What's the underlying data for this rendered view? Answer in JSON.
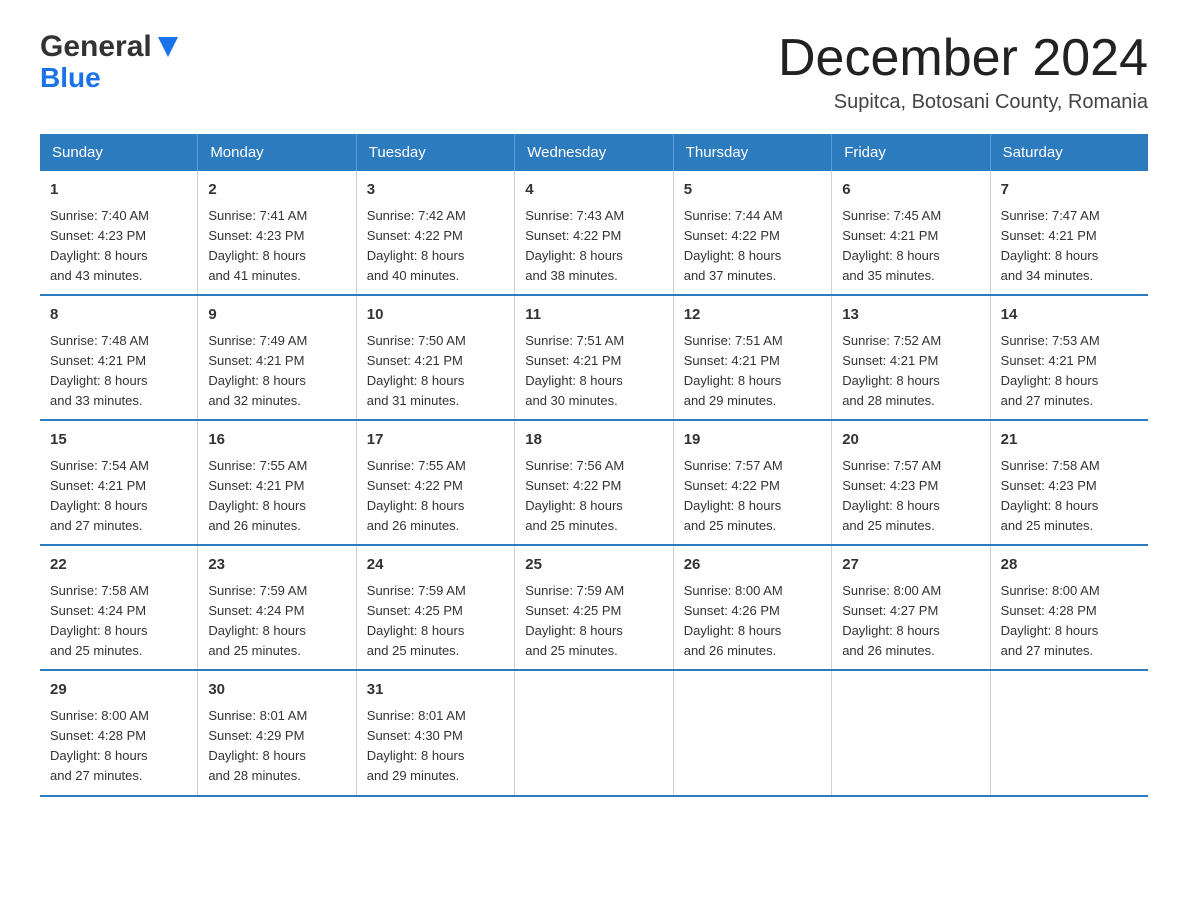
{
  "header": {
    "logo_general": "General",
    "logo_blue": "Blue",
    "title": "December 2024",
    "subtitle": "Supitca, Botosani County, Romania"
  },
  "days_of_week": [
    "Sunday",
    "Monday",
    "Tuesday",
    "Wednesday",
    "Thursday",
    "Friday",
    "Saturday"
  ],
  "weeks": [
    [
      {
        "day": "1",
        "sunrise": "7:40 AM",
        "sunset": "4:23 PM",
        "daylight_h": "8",
        "daylight_m": "43"
      },
      {
        "day": "2",
        "sunrise": "7:41 AM",
        "sunset": "4:23 PM",
        "daylight_h": "8",
        "daylight_m": "41"
      },
      {
        "day": "3",
        "sunrise": "7:42 AM",
        "sunset": "4:22 PM",
        "daylight_h": "8",
        "daylight_m": "40"
      },
      {
        "day": "4",
        "sunrise": "7:43 AM",
        "sunset": "4:22 PM",
        "daylight_h": "8",
        "daylight_m": "38"
      },
      {
        "day": "5",
        "sunrise": "7:44 AM",
        "sunset": "4:22 PM",
        "daylight_h": "8",
        "daylight_m": "37"
      },
      {
        "day": "6",
        "sunrise": "7:45 AM",
        "sunset": "4:21 PM",
        "daylight_h": "8",
        "daylight_m": "35"
      },
      {
        "day": "7",
        "sunrise": "7:47 AM",
        "sunset": "4:21 PM",
        "daylight_h": "8",
        "daylight_m": "34"
      }
    ],
    [
      {
        "day": "8",
        "sunrise": "7:48 AM",
        "sunset": "4:21 PM",
        "daylight_h": "8",
        "daylight_m": "33"
      },
      {
        "day": "9",
        "sunrise": "7:49 AM",
        "sunset": "4:21 PM",
        "daylight_h": "8",
        "daylight_m": "32"
      },
      {
        "day": "10",
        "sunrise": "7:50 AM",
        "sunset": "4:21 PM",
        "daylight_h": "8",
        "daylight_m": "31"
      },
      {
        "day": "11",
        "sunrise": "7:51 AM",
        "sunset": "4:21 PM",
        "daylight_h": "8",
        "daylight_m": "30"
      },
      {
        "day": "12",
        "sunrise": "7:51 AM",
        "sunset": "4:21 PM",
        "daylight_h": "8",
        "daylight_m": "29"
      },
      {
        "day": "13",
        "sunrise": "7:52 AM",
        "sunset": "4:21 PM",
        "daylight_h": "8",
        "daylight_m": "28"
      },
      {
        "day": "14",
        "sunrise": "7:53 AM",
        "sunset": "4:21 PM",
        "daylight_h": "8",
        "daylight_m": "27"
      }
    ],
    [
      {
        "day": "15",
        "sunrise": "7:54 AM",
        "sunset": "4:21 PM",
        "daylight_h": "8",
        "daylight_m": "27"
      },
      {
        "day": "16",
        "sunrise": "7:55 AM",
        "sunset": "4:21 PM",
        "daylight_h": "8",
        "daylight_m": "26"
      },
      {
        "day": "17",
        "sunrise": "7:55 AM",
        "sunset": "4:22 PM",
        "daylight_h": "8",
        "daylight_m": "26"
      },
      {
        "day": "18",
        "sunrise": "7:56 AM",
        "sunset": "4:22 PM",
        "daylight_h": "8",
        "daylight_m": "25"
      },
      {
        "day": "19",
        "sunrise": "7:57 AM",
        "sunset": "4:22 PM",
        "daylight_h": "8",
        "daylight_m": "25"
      },
      {
        "day": "20",
        "sunrise": "7:57 AM",
        "sunset": "4:23 PM",
        "daylight_h": "8",
        "daylight_m": "25"
      },
      {
        "day": "21",
        "sunrise": "7:58 AM",
        "sunset": "4:23 PM",
        "daylight_h": "8",
        "daylight_m": "25"
      }
    ],
    [
      {
        "day": "22",
        "sunrise": "7:58 AM",
        "sunset": "4:24 PM",
        "daylight_h": "8",
        "daylight_m": "25"
      },
      {
        "day": "23",
        "sunrise": "7:59 AM",
        "sunset": "4:24 PM",
        "daylight_h": "8",
        "daylight_m": "25"
      },
      {
        "day": "24",
        "sunrise": "7:59 AM",
        "sunset": "4:25 PM",
        "daylight_h": "8",
        "daylight_m": "25"
      },
      {
        "day": "25",
        "sunrise": "7:59 AM",
        "sunset": "4:25 PM",
        "daylight_h": "8",
        "daylight_m": "25"
      },
      {
        "day": "26",
        "sunrise": "8:00 AM",
        "sunset": "4:26 PM",
        "daylight_h": "8",
        "daylight_m": "26"
      },
      {
        "day": "27",
        "sunrise": "8:00 AM",
        "sunset": "4:27 PM",
        "daylight_h": "8",
        "daylight_m": "26"
      },
      {
        "day": "28",
        "sunrise": "8:00 AM",
        "sunset": "4:28 PM",
        "daylight_h": "8",
        "daylight_m": "27"
      }
    ],
    [
      {
        "day": "29",
        "sunrise": "8:00 AM",
        "sunset": "4:28 PM",
        "daylight_h": "8",
        "daylight_m": "27"
      },
      {
        "day": "30",
        "sunrise": "8:01 AM",
        "sunset": "4:29 PM",
        "daylight_h": "8",
        "daylight_m": "28"
      },
      {
        "day": "31",
        "sunrise": "8:01 AM",
        "sunset": "4:30 PM",
        "daylight_h": "8",
        "daylight_m": "29"
      },
      null,
      null,
      null,
      null
    ]
  ],
  "labels": {
    "sunrise": "Sunrise:",
    "sunset": "Sunset:",
    "daylight": "Daylight:",
    "hours": "hours",
    "and": "and",
    "minutes": "minutes."
  }
}
